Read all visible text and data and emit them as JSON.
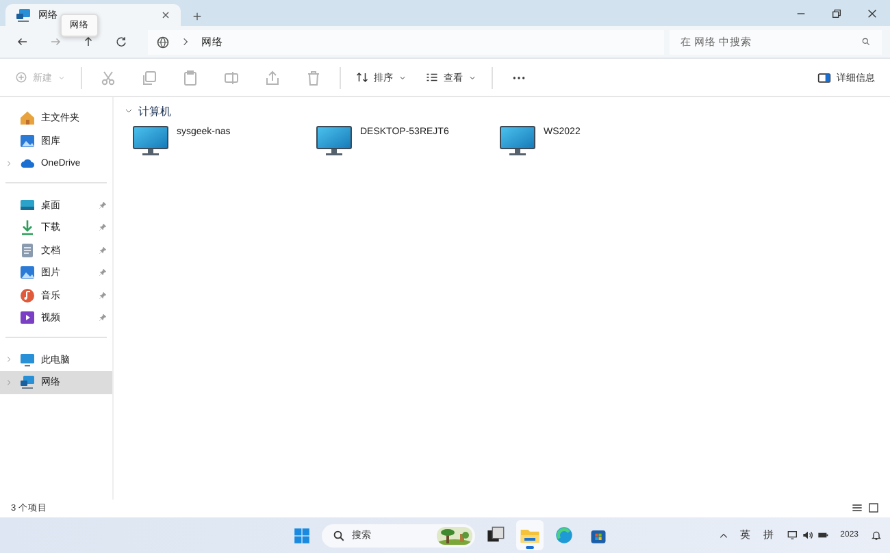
{
  "tabs": [
    {
      "label": "网络",
      "selected": true
    }
  ],
  "tooltip": "网络",
  "address": {
    "segments": [
      "网络"
    ]
  },
  "search": {
    "placeholder": "在 网络 中搜索"
  },
  "toolbar": {
    "new_label": "新建",
    "new_disabled": true,
    "actions": [
      {
        "kind": "cut",
        "disabled": true
      },
      {
        "kind": "copy",
        "disabled": true
      },
      {
        "kind": "paste",
        "disabled": true
      },
      {
        "kind": "rename",
        "disabled": true
      },
      {
        "kind": "share",
        "disabled": true
      },
      {
        "kind": "delete",
        "disabled": true
      }
    ],
    "sort_label": "排序",
    "view_label": "查看",
    "details_label": "详细信息"
  },
  "sidebar": {
    "groups": [
      [
        {
          "label": "主文件夹",
          "kind": "home",
          "expandable": false,
          "pinned": false,
          "selected": false
        },
        {
          "label": "图库",
          "kind": "gallery",
          "expandable": false,
          "pinned": false,
          "selected": false
        },
        {
          "label": "OneDrive",
          "kind": "cloud",
          "expandable": true,
          "pinned": false,
          "selected": false
        }
      ],
      [
        {
          "label": "桌面",
          "kind": "desktop",
          "expandable": false,
          "pinned": true,
          "selected": false
        },
        {
          "label": "下载",
          "kind": "download",
          "expandable": false,
          "pinned": true,
          "selected": false
        },
        {
          "label": "文档",
          "kind": "document",
          "expandable": false,
          "pinned": true,
          "selected": false
        },
        {
          "label": "图片",
          "kind": "pictures",
          "expandable": false,
          "pinned": true,
          "selected": false
        },
        {
          "label": "音乐",
          "kind": "music",
          "expandable": false,
          "pinned": true,
          "selected": false
        },
        {
          "label": "视频",
          "kind": "video",
          "expandable": false,
          "pinned": true,
          "selected": false
        }
      ],
      [
        {
          "label": "此电脑",
          "kind": "pc",
          "expandable": true,
          "pinned": false,
          "selected": false
        },
        {
          "label": "网络",
          "kind": "network",
          "expandable": true,
          "pinned": false,
          "selected": true
        }
      ]
    ]
  },
  "section": {
    "title": "计算机",
    "expanded": true,
    "items": [
      {
        "name": "sysgeek-nas"
      },
      {
        "name": "DESKTOP-53REJT6"
      },
      {
        "name": "WS2022"
      }
    ]
  },
  "status_bar": {
    "count": "3 个项目"
  },
  "taskbar": {
    "search_placeholder": "搜索",
    "apps": [
      {
        "kind": "taskview",
        "active": false
      },
      {
        "kind": "explorer",
        "active": true
      },
      {
        "kind": "edge",
        "active": false
      },
      {
        "kind": "store",
        "active": false
      }
    ],
    "tray": {
      "ime1": "英",
      "ime2": "拼",
      "clock": "2023"
    }
  }
}
